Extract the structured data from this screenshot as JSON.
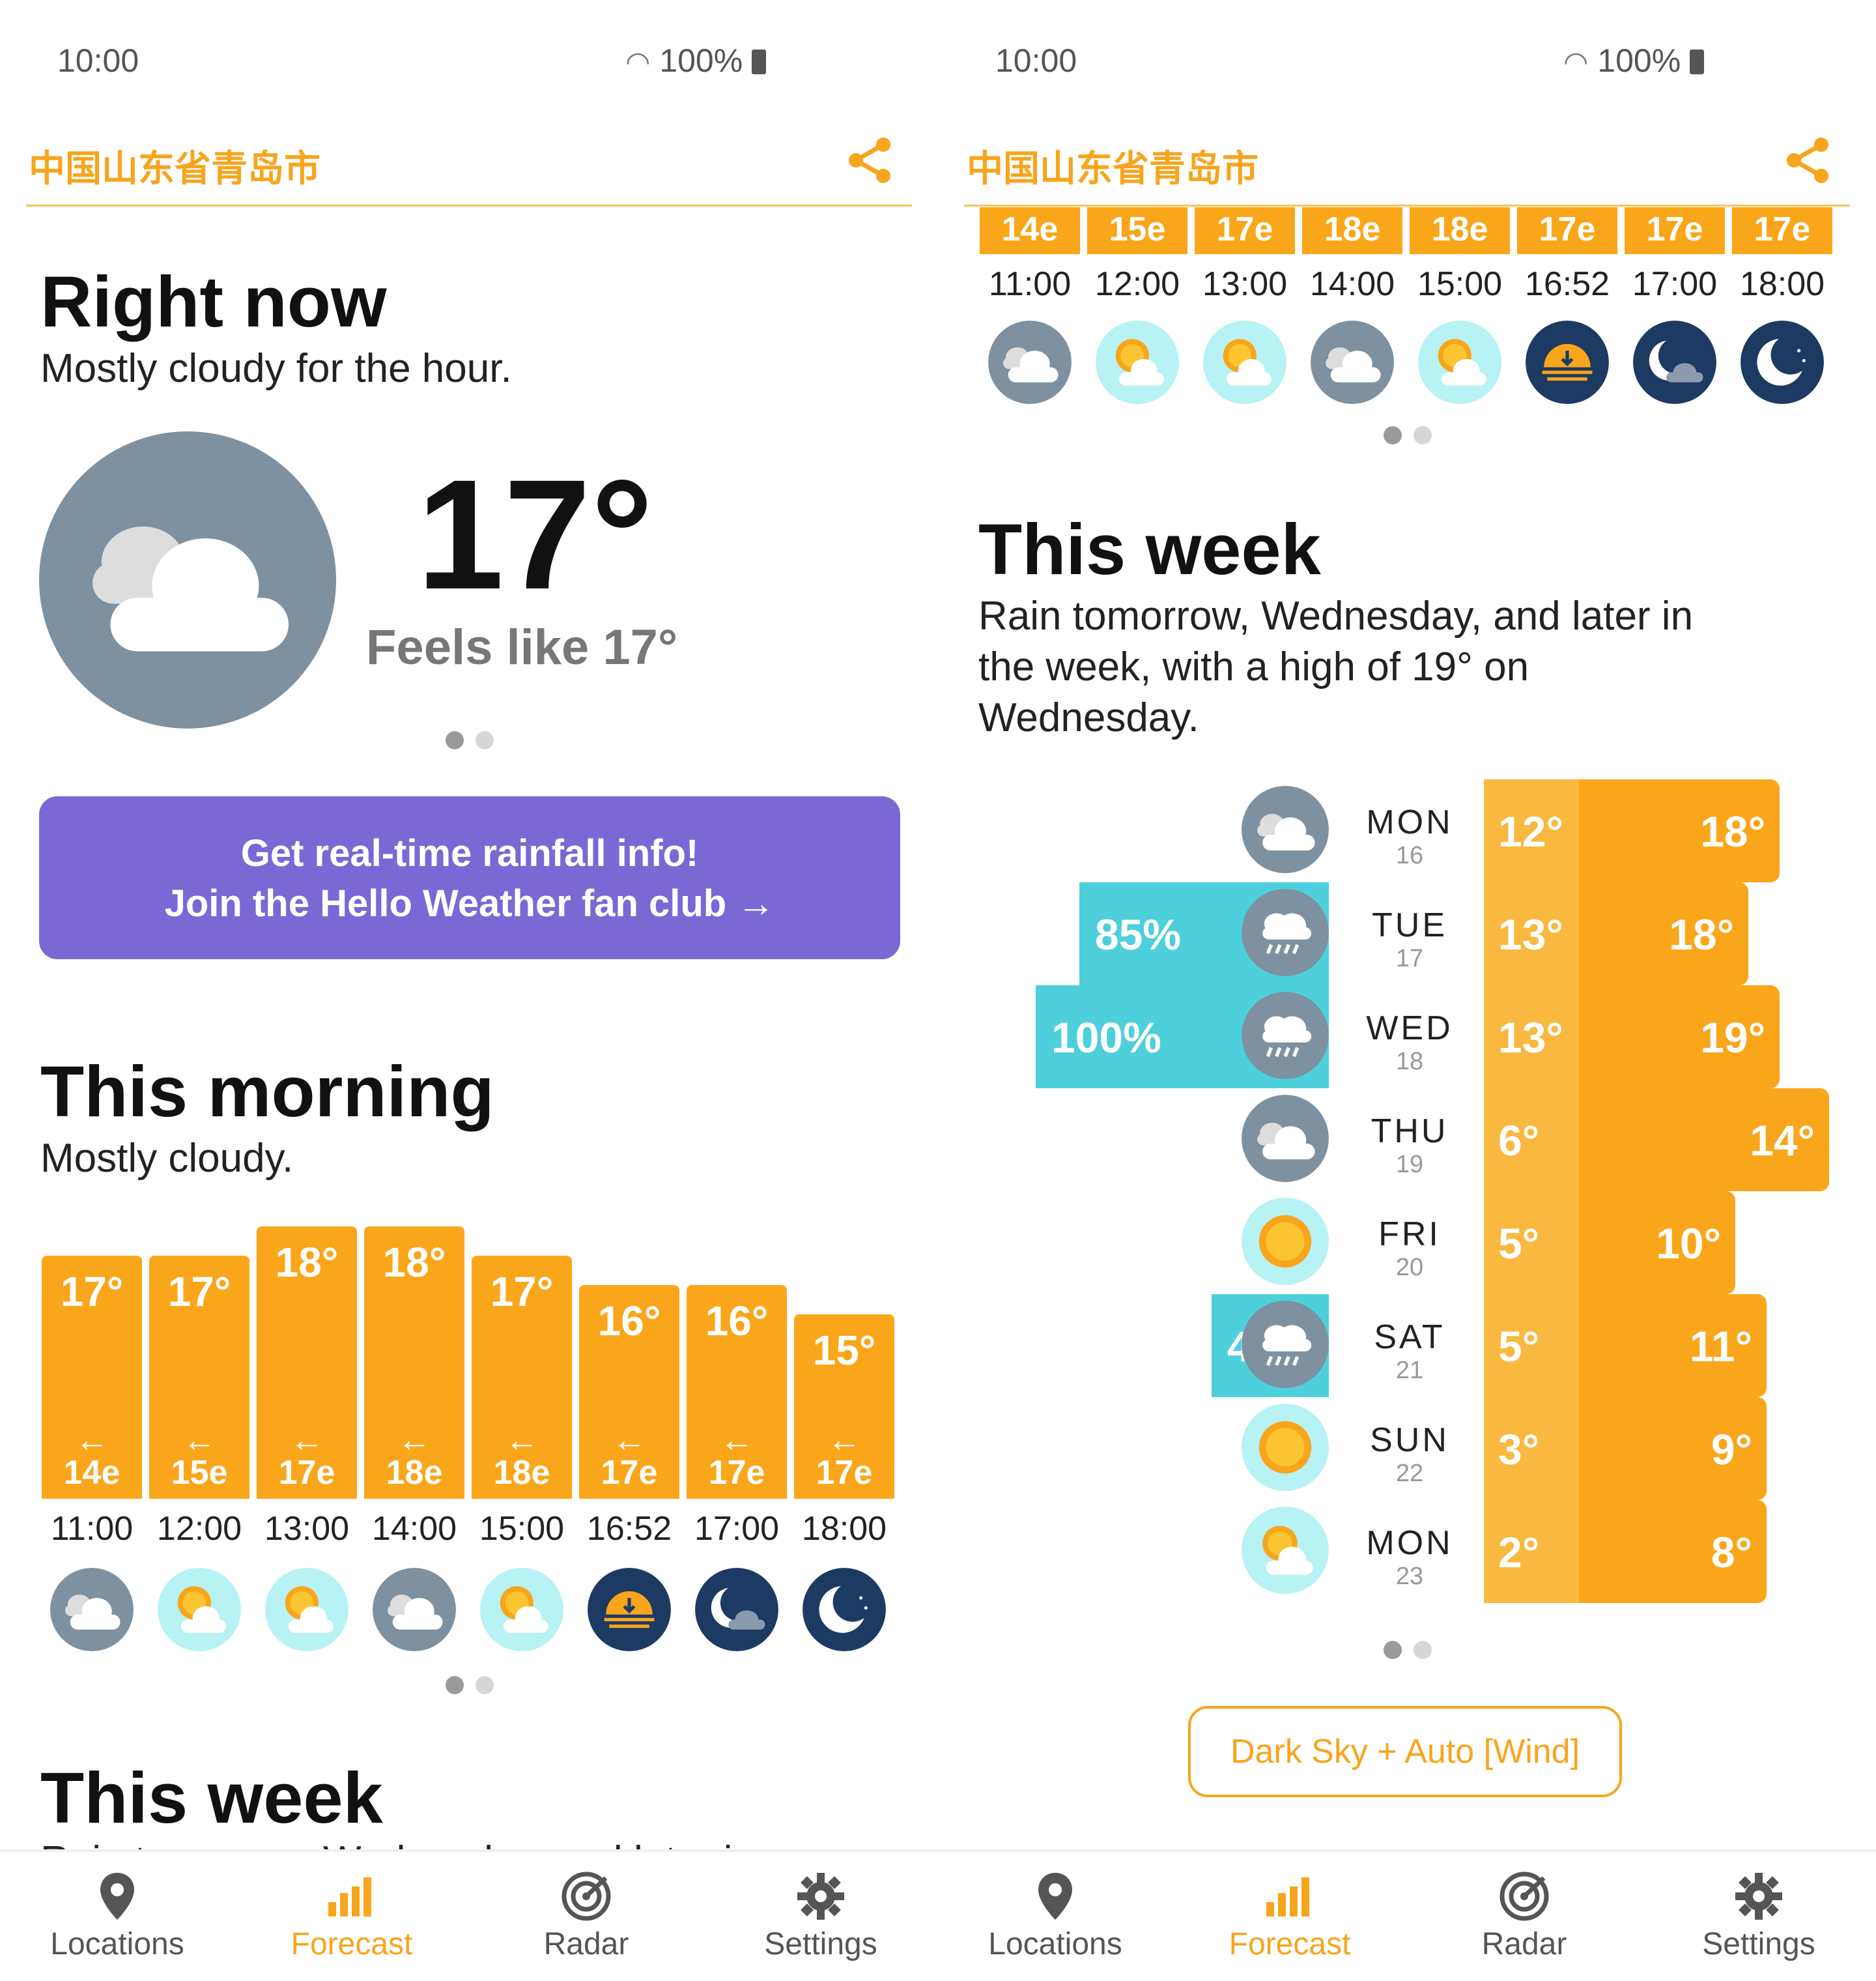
{
  "colors": {
    "accent": "#F7A51D",
    "bar": "#FAA61A",
    "rain": "#4DD0DB",
    "promo": "#7B68D4",
    "cloudy": "#7D91A0",
    "sunny": "#A9F1F4",
    "night": "#1D3A63"
  },
  "status": {
    "time": "10:00",
    "battery": "100%"
  },
  "location": "中国山东省青岛市",
  "left": {
    "right_now": {
      "title": "Right now",
      "summary": "Mostly cloudy for the hour.",
      "temp": "17°",
      "feels": "Feels like 17°",
      "icon": "cloudy-icon"
    },
    "promo": {
      "line1": "Get real-time rainfall info!",
      "line2": "Join the Hello Weather fan club →"
    },
    "morning": {
      "title": "This morning",
      "summary": "Mostly cloudy."
    },
    "week": {
      "title": "This week",
      "summary_partial": "Rain tomorrow, Wednesday, and later in"
    }
  },
  "hourly": [
    {
      "time": "11:00",
      "temp": "17°",
      "temp_value": 17,
      "wind": "14e",
      "arrow": "←",
      "icon": "cloudy"
    },
    {
      "time": "12:00",
      "temp": "17°",
      "temp_value": 17,
      "wind": "15e",
      "arrow": "←",
      "icon": "partly-sunny"
    },
    {
      "time": "13:00",
      "temp": "18°",
      "temp_value": 18,
      "wind": "17e",
      "arrow": "←",
      "icon": "partly-sunny"
    },
    {
      "time": "14:00",
      "temp": "18°",
      "temp_value": 18,
      "wind": "18e",
      "arrow": "←",
      "icon": "cloudy"
    },
    {
      "time": "15:00",
      "temp": "17°",
      "temp_value": 17,
      "wind": "18e",
      "arrow": "←",
      "icon": "partly-sunny"
    },
    {
      "time": "16:52",
      "temp": "16°",
      "temp_value": 16,
      "wind": "17e",
      "arrow": "←",
      "icon": "sunset"
    },
    {
      "time": "17:00",
      "temp": "16°",
      "temp_value": 16,
      "wind": "17e",
      "arrow": "←",
      "icon": "night-cloudy"
    },
    {
      "time": "18:00",
      "temp": "15°",
      "temp_value": 15,
      "wind": "17e",
      "arrow": "←",
      "icon": "night"
    }
  ],
  "right": {
    "week": {
      "title": "This week",
      "line1": "Rain tomorrow, Wednesday, and later in",
      "line2": "the week, with a high of 19° on",
      "line3": "Wednesday."
    },
    "source_button": "Dark Sky + Auto [Wind]"
  },
  "daily": [
    {
      "day": "MON",
      "date": "16",
      "rain": "",
      "rain_value": 0,
      "low": "12°",
      "high": "18°",
      "low_value": 12,
      "high_value": 18,
      "icon": "cloudy"
    },
    {
      "day": "TUE",
      "date": "17",
      "rain": "85%",
      "rain_value": 85,
      "low": "13°",
      "high": "18°",
      "low_value": 13,
      "high_value": 18,
      "icon": "rain"
    },
    {
      "day": "WED",
      "date": "18",
      "rain": "100%",
      "rain_value": 100,
      "low": "13°",
      "high": "19°",
      "low_value": 13,
      "high_value": 19,
      "icon": "rain"
    },
    {
      "day": "THU",
      "date": "19",
      "rain": "",
      "rain_value": 0,
      "low": "6°",
      "high": "14°",
      "low_value": 6,
      "high_value": 14,
      "icon": "cloudy"
    },
    {
      "day": "FRI",
      "date": "20",
      "rain": "",
      "rain_value": 0,
      "low": "5°",
      "high": "10°",
      "low_value": 5,
      "high_value": 10,
      "icon": "sunny"
    },
    {
      "day": "SAT",
      "date": "21",
      "rain": "40%",
      "rain_value": 40,
      "low": "5°",
      "high": "11°",
      "low_value": 5,
      "high_value": 11,
      "icon": "rain"
    },
    {
      "day": "SUN",
      "date": "22",
      "rain": "",
      "rain_value": 0,
      "low": "3°",
      "high": "9°",
      "low_value": 3,
      "high_value": 9,
      "icon": "sunny"
    },
    {
      "day": "MON",
      "date": "23",
      "rain": "",
      "rain_value": 0,
      "low": "2°",
      "high": "8°",
      "low_value": 2,
      "high_value": 8,
      "icon": "partly-sunny"
    }
  ],
  "nav": [
    {
      "label": "Locations",
      "icon": "location-pin-icon",
      "active": false
    },
    {
      "label": "Forecast",
      "icon": "bar-chart-icon",
      "active": true
    },
    {
      "label": "Radar",
      "icon": "radar-icon",
      "active": false
    },
    {
      "label": "Settings",
      "icon": "gear-icon",
      "active": false
    }
  ]
}
